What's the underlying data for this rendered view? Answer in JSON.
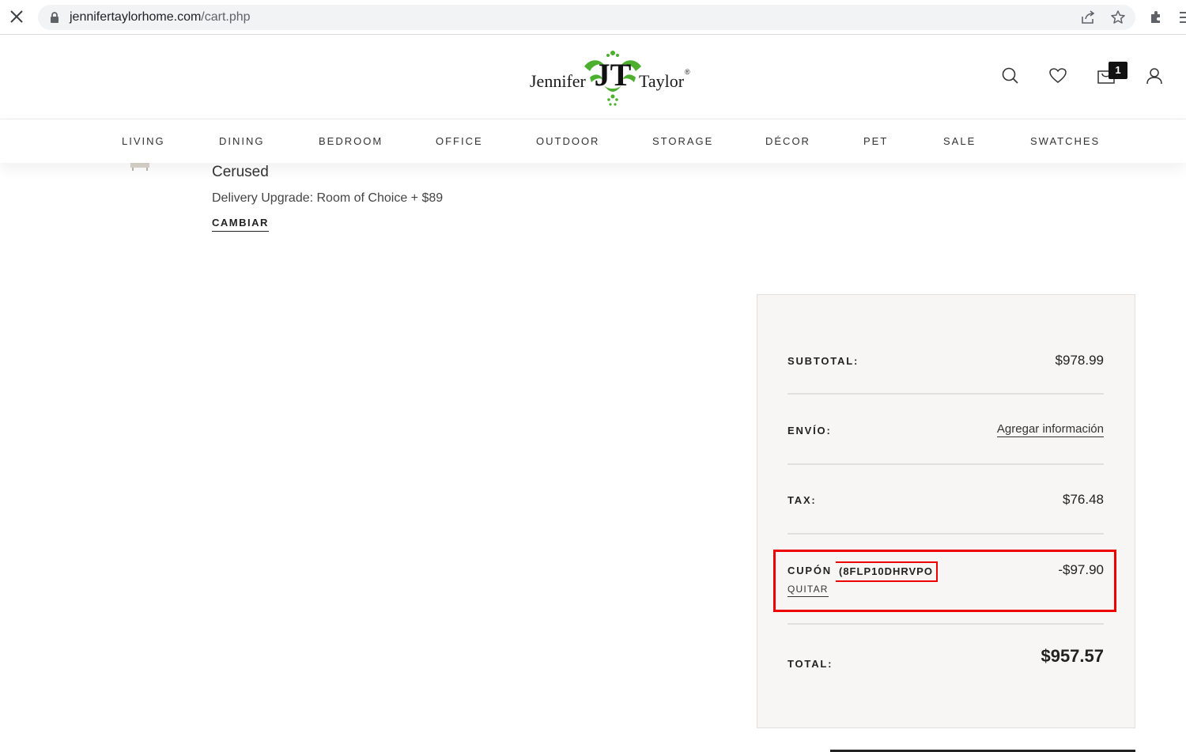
{
  "browser": {
    "url_host": "jennifertaylorhome.com",
    "url_path": "/cart.php"
  },
  "header": {
    "logo_left": "Jennifer",
    "logo_right": "Taylor",
    "logo_mark": "JT",
    "logo_reg": "®",
    "cart_count": "1",
    "icons": [
      "search-icon",
      "heart-icon",
      "cart-icon",
      "account-icon"
    ]
  },
  "nav": {
    "items": [
      "LIVING",
      "DINING",
      "BEDROOM",
      "OFFICE",
      "OUTDOOR",
      "STORAGE",
      "DÉCOR",
      "PET",
      "SALE",
      "SWATCHES"
    ]
  },
  "cart_item": {
    "variant": "Cerused",
    "option": "Delivery Upgrade: Room of Choice + $89",
    "change_label": "CAMBIAR"
  },
  "summary": {
    "subtotal_label": "SUBTOTAL:",
    "subtotal_value": "$978.99",
    "shipping_label": "ENVÍO:",
    "shipping_link": "Agregar información",
    "tax_label": "TAX:",
    "tax_value": "$76.48",
    "coupon_label": "CUPÓN",
    "coupon_code": "(8FLP10DHRVPO",
    "coupon_value": "-$97.90",
    "coupon_remove": "QUITAR",
    "total_label": "TOTAL:",
    "total_value": "$957.57"
  },
  "colors": {
    "logo_green": "#4caf2e",
    "highlight_red": "#e00000",
    "summary_bg": "#f7f6f4"
  }
}
